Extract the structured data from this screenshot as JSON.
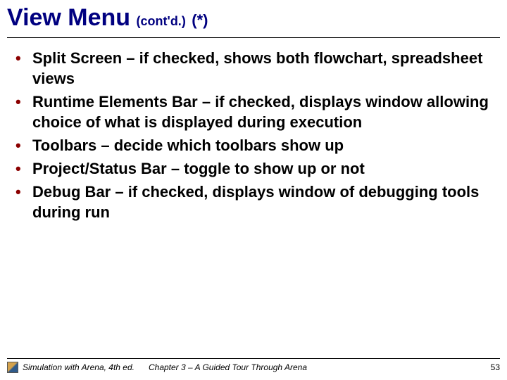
{
  "title": {
    "main": "View Menu",
    "sub": "(cont'd.)",
    "aster": "(*)"
  },
  "bullets": [
    "Split Screen – if checked, shows both flowchart, spreadsheet views",
    "Runtime Elements Bar – if checked, displays window allowing choice of what is displayed during execution",
    "Toolbars – decide which toolbars show up",
    "Project/Status Bar – toggle to show up or not",
    "Debug Bar – if checked, displays window of debugging tools during run"
  ],
  "footer": {
    "left": "Simulation with Arena, 4th ed.",
    "center": "Chapter 3 – A Guided Tour Through Arena",
    "page": "53"
  }
}
